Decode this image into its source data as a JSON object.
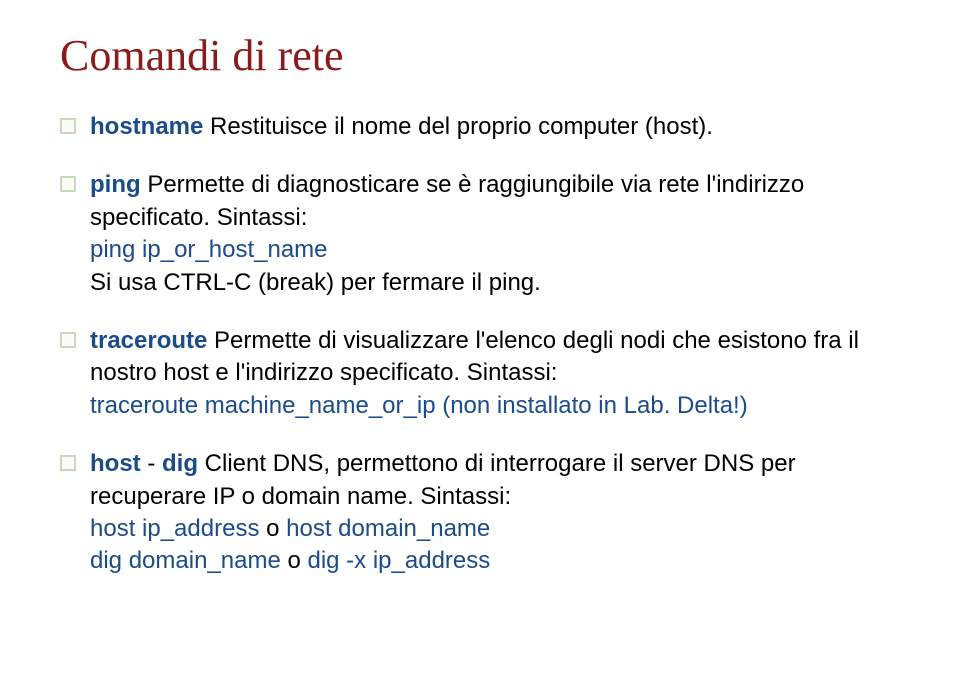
{
  "title": "Comandi di rete",
  "b1": {
    "kw": "hostname",
    "text": " Restituisce il nome del proprio computer (host)."
  },
  "b2": {
    "kw": "ping",
    "t1": " Permette di diagnosticare se è raggiungibile via rete l'indirizzo specificato. Sintassi:",
    "cmd": "ping ip_or_host_name",
    "t2": "Si usa CTRL-C (break) per fermare il ping."
  },
  "b3": {
    "kw": "traceroute",
    "t1": " Permette di visualizzare l'elenco degli nodi che esistono fra il nostro host e l'indirizzo specificato. Sintassi:",
    "cmd": "traceroute machine_name_or_ip (non installato in Lab. Delta!)"
  },
  "b4": {
    "kw": "host",
    "sep": " - ",
    "kw2": "dig",
    "t1": " Client DNS, permettono di interrogare il server DNS per recuperare IP o domain name. Sintassi:",
    "c1a": "host ip_address",
    "c1o": " o ",
    "c1b": "host domain_name",
    "c2a": "dig domain_name",
    "c2o": " o ",
    "c2b": "dig -x ip_address"
  }
}
